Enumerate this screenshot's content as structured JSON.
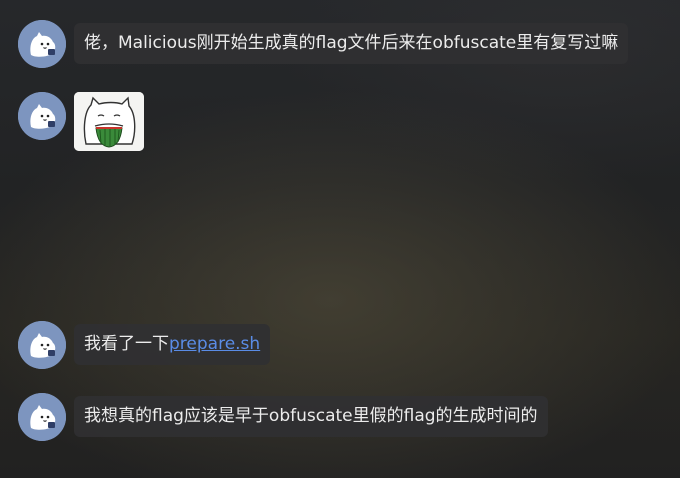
{
  "messages": [
    {
      "text": "佬，Malicious刚开始生成真的flag文件后来在obfuscate里有复写过嘛"
    },
    {
      "sticker": "cat-eating-watermelon-sticker"
    },
    {
      "prefix": "我看了一下",
      "link": "prepare.sh"
    },
    {
      "text": "我想真的flag应该是早于obfuscate里假的flag的生成时间的"
    }
  ],
  "colors": {
    "avatar_bg": "#7d95bf",
    "bubble_bg": "#303032",
    "link": "#5a8ce6"
  }
}
